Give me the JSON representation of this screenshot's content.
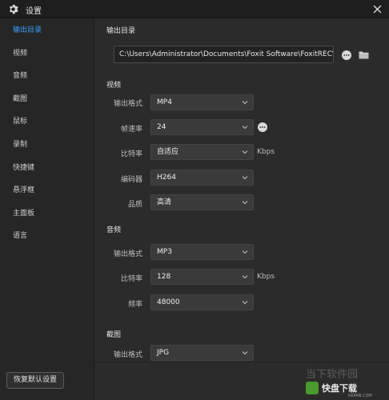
{
  "window": {
    "title": "设置",
    "icon": "gear-icon",
    "close_icon": "close-icon"
  },
  "sidebar": {
    "items": [
      {
        "label": "输出目录",
        "active": true
      },
      {
        "label": "视频"
      },
      {
        "label": "音频"
      },
      {
        "label": "截图"
      },
      {
        "label": "鼠标"
      },
      {
        "label": "录制"
      },
      {
        "label": "快捷键"
      },
      {
        "label": "悬浮框"
      },
      {
        "label": "主面板"
      },
      {
        "label": "语言"
      }
    ],
    "reset_label": "恢复默认设置"
  },
  "output": {
    "title": "输出目录",
    "path": "C:\\Users\\Administrator\\Documents\\Foxit Software\\FoxitREC\\",
    "more_icon": "more-icon",
    "folder_icon": "folder-icon"
  },
  "video": {
    "title": "视频",
    "rows": [
      {
        "label": "输出格式",
        "value": "MP4"
      },
      {
        "label": "帧速率",
        "value": "24"
      },
      {
        "label": "比特率",
        "value": "自适应",
        "unit": "Kbps"
      },
      {
        "label": "编码器",
        "value": "H264"
      },
      {
        "label": "品质",
        "value": "高清"
      }
    ]
  },
  "audio": {
    "title": "音频",
    "rows": [
      {
        "label": "输出格式",
        "value": "MP3"
      },
      {
        "label": "比特率",
        "value": "128",
        "unit": "Kbps"
      },
      {
        "label": "频率",
        "value": "48000"
      }
    ]
  },
  "screenshot": {
    "title": "截图",
    "rows": [
      {
        "label": "输出格式",
        "value": "JPG"
      }
    ]
  },
  "watermark": {
    "main": "当下软件园",
    "sub": "www.downxia.com",
    "badge": "快盘下载",
    "badge_sub": "KKPAN.COM"
  },
  "colors": {
    "accent": "#3aa0ff",
    "background": "#2b2b2b",
    "sidebar": "#262626"
  }
}
